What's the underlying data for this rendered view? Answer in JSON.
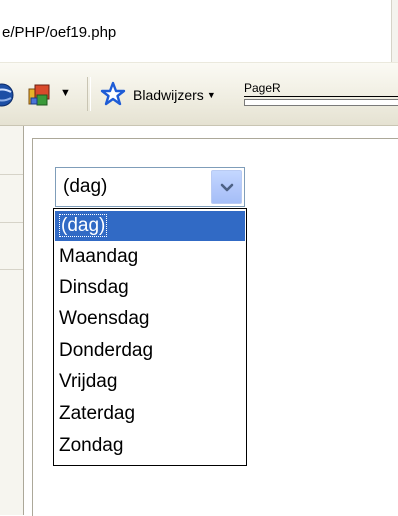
{
  "browser": {
    "address_url": "e/PHP/oef19.php",
    "bookmarks_label": "Bladwijzers",
    "pagerank_label": "PageR"
  },
  "form": {
    "day_select": {
      "selected": "(dag)",
      "options": [
        "(dag)",
        "Maandag",
        "Dinsdag",
        "Woensdag",
        "Donderdag",
        "Vrijdag",
        "Zaterdag",
        "Zondag"
      ],
      "highlighted_index": 0
    }
  },
  "colors": {
    "highlight": "#316ac5",
    "select_border": "#7f9db9",
    "toolbar_star": "#1e5cd6"
  },
  "icons": [
    "globe-icon",
    "toolbar-extension-icon",
    "dropdown-arrow-icon",
    "star-icon",
    "chevron-down-icon"
  ]
}
